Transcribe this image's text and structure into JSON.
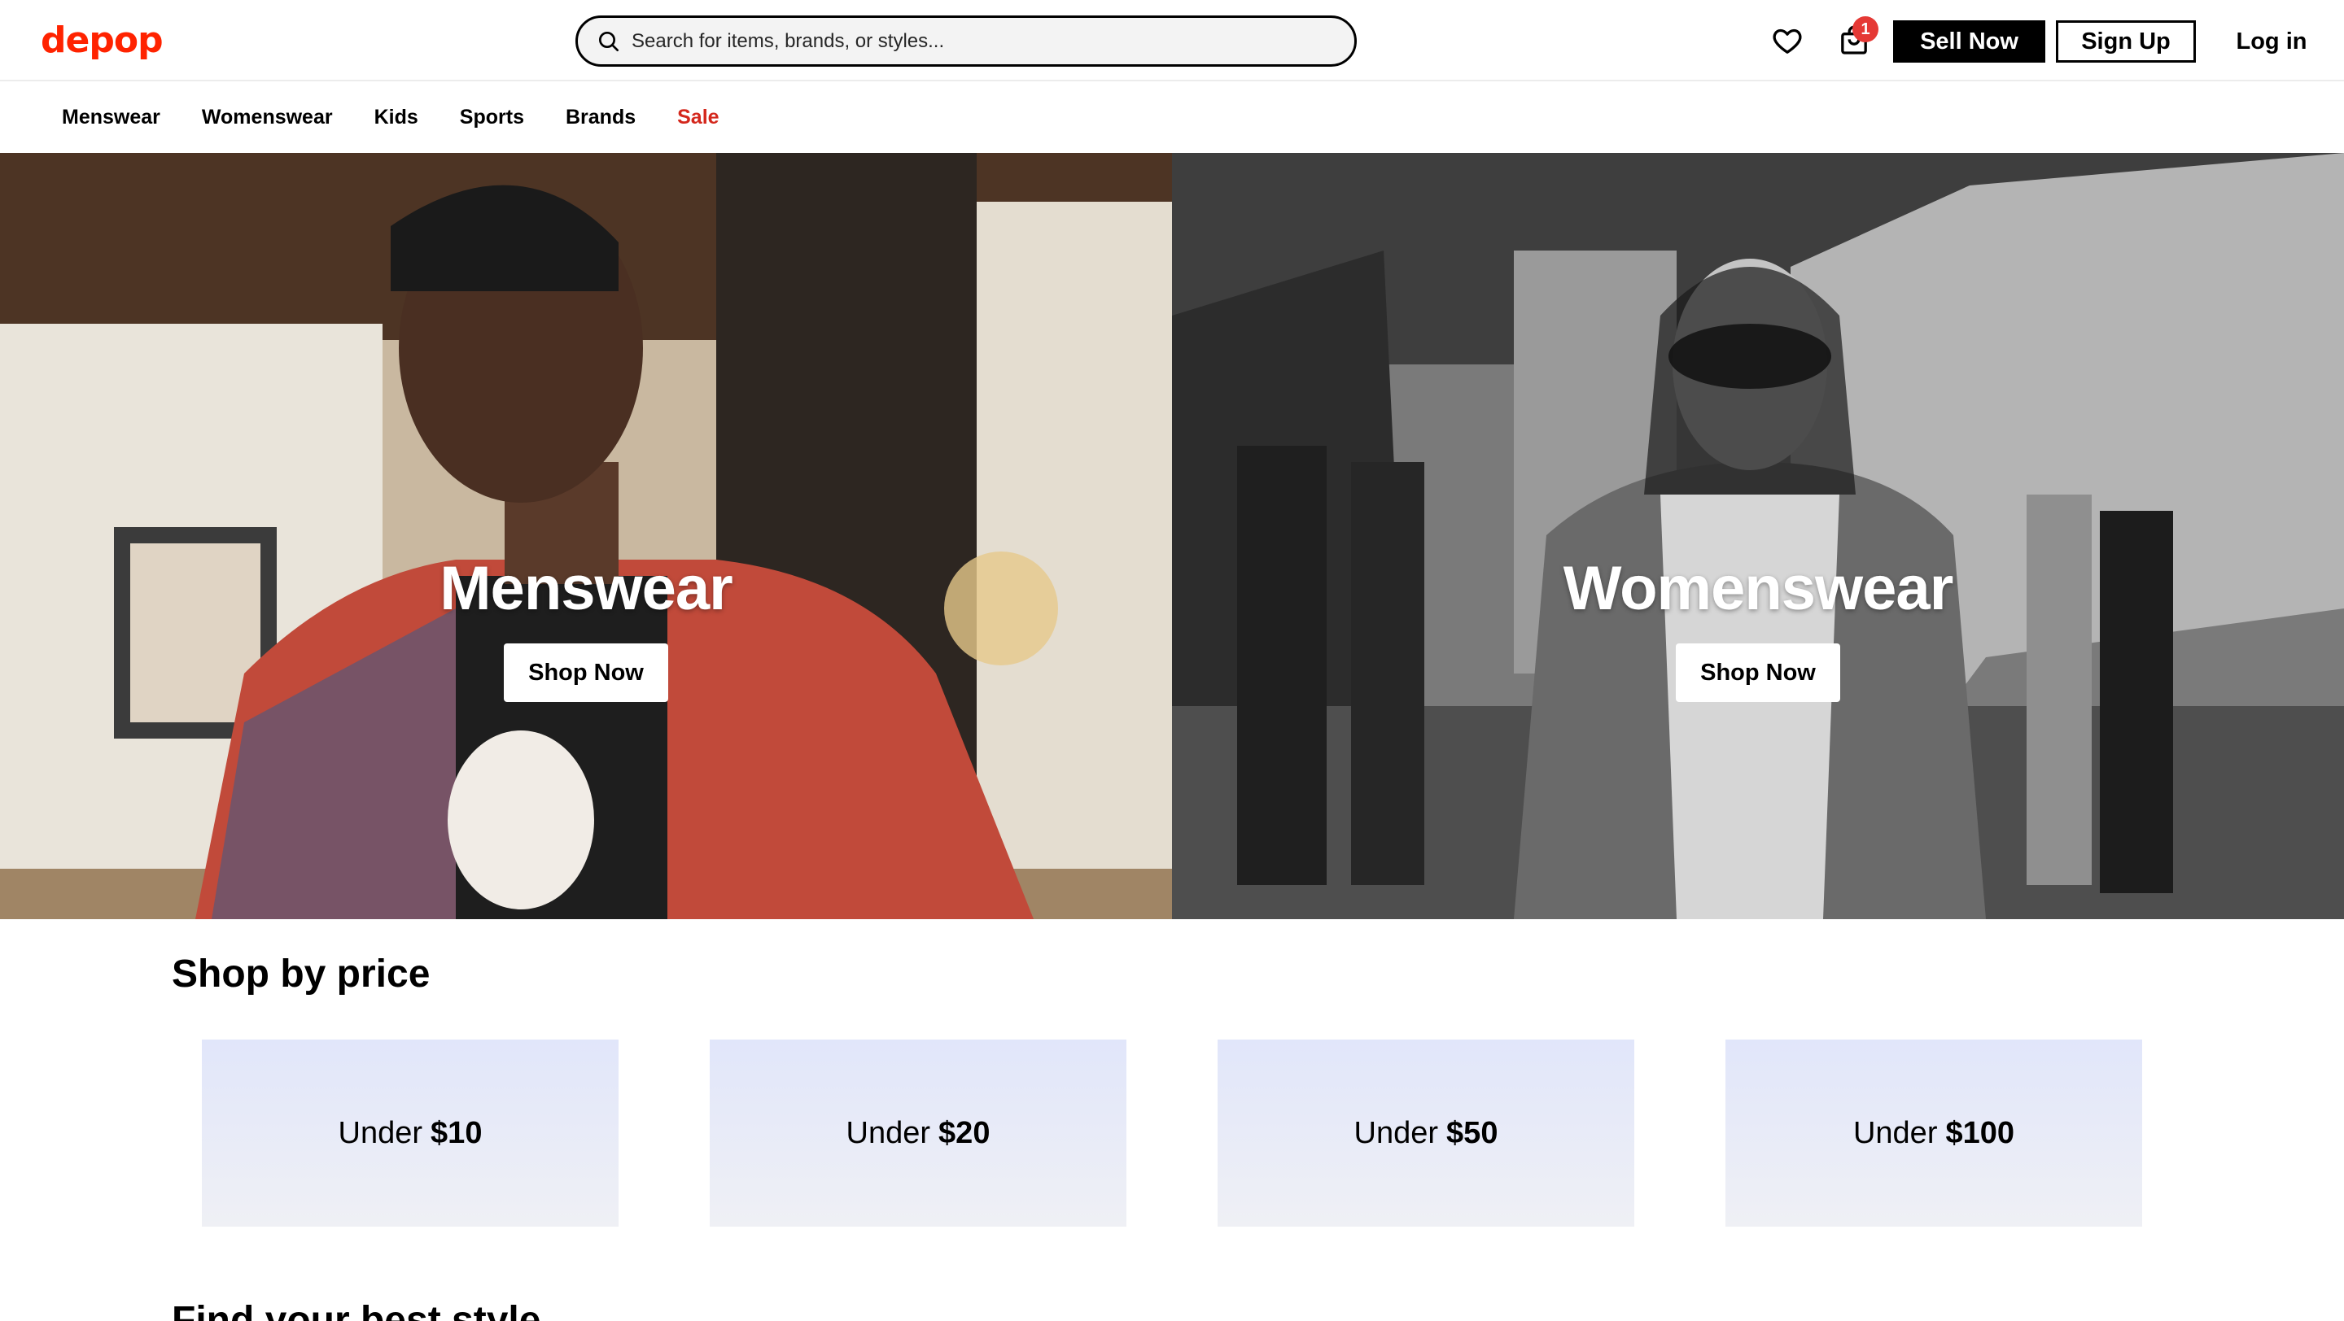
{
  "header": {
    "logo": "depop",
    "search_placeholder": "Search for items, brands, or styles...",
    "bag_count": "1",
    "sell_label": "Sell Now",
    "signup_label": "Sign Up",
    "login_label": "Log in",
    "icons": [
      "search-icon",
      "heart-icon",
      "shopping-bag-icon"
    ]
  },
  "nav": {
    "items": [
      {
        "label": "Menswear"
      },
      {
        "label": "Womenswear"
      },
      {
        "label": "Kids"
      },
      {
        "label": "Sports"
      },
      {
        "label": "Brands"
      },
      {
        "label": "Sale"
      }
    ]
  },
  "hero": [
    {
      "title": "Menswear",
      "button": "Shop Now"
    },
    {
      "title": "Womenswear",
      "button": "Shop Now"
    }
  ],
  "shop_by_price": {
    "title": "Shop by price",
    "cards": [
      {
        "prefix": "Under",
        "amount": "$10"
      },
      {
        "prefix": "Under",
        "amount": "$20"
      },
      {
        "prefix": "Under",
        "amount": "$50"
      },
      {
        "prefix": "Under",
        "amount": "$100"
      }
    ]
  },
  "next_section": {
    "title": "Find your best style"
  },
  "colors": {
    "brand": "#ff2300",
    "sale": "#d4271c",
    "badge": "#e53935",
    "price_card_top": "#e1e6fa",
    "price_card_bottom": "#eff0f5"
  }
}
